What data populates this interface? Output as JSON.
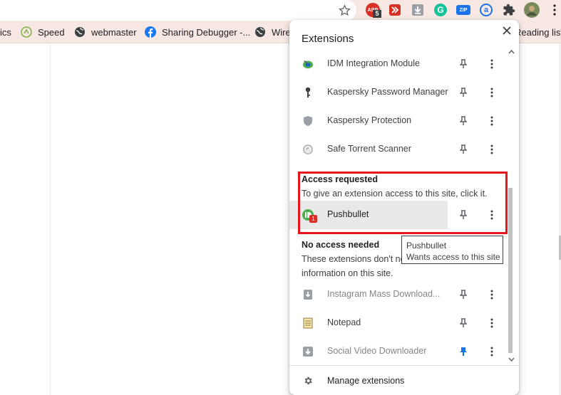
{
  "toolbar": {
    "icons": [
      "star-icon",
      "abp-icon",
      "bookmark-extension-icon",
      "download-icon",
      "grammarly-icon",
      "zip-icon",
      "atavi-icon",
      "extensions-puzzle-icon",
      "profile-avatar",
      "chrome-menu-icon"
    ],
    "abp_label": "ABP",
    "abp_badge": "5",
    "grammarly_label": "G",
    "zip_label": "ZIP",
    "atavi_label": "a"
  },
  "bookmarks": {
    "items": [
      {
        "label": "ics",
        "icon": "none"
      },
      {
        "label": "Speed",
        "icon": "speed-icon"
      },
      {
        "label": "webmaster",
        "icon": "globe-icon"
      },
      {
        "label": "Sharing Debugger -...",
        "icon": "facebook-icon"
      },
      {
        "label": "Wirel",
        "icon": "globe-icon"
      }
    ],
    "reading_list": "Reading list"
  },
  "popup": {
    "title": "Extensions",
    "extensions_top": [
      {
        "name": "IDM Integration Module",
        "icon": "idm-icon"
      },
      {
        "name": "Kaspersky Password Manager",
        "icon": "key-icon"
      },
      {
        "name": "Kaspersky Protection",
        "icon": "shield-icon"
      },
      {
        "name": "Safe Torrent Scanner",
        "icon": "torrent-icon"
      }
    ],
    "access_requested": {
      "title": "Access requested",
      "description": "To give an extension access to this site, click it.",
      "extension": {
        "name": "Pushbullet",
        "badge": "1",
        "icon": "pushbullet-icon"
      }
    },
    "no_access": {
      "title": "No access needed",
      "description_line1": "These extensions don't ne",
      "description_line2": "information on this site.",
      "extensions": [
        {
          "name": "Instagram Mass Download...",
          "icon": "instagram-download-icon",
          "pinned": false
        },
        {
          "name": "Notepad",
          "icon": "notepad-icon",
          "pinned": false
        },
        {
          "name": "Social Video Downloader",
          "icon": "video-download-icon",
          "pinned": true
        }
      ]
    },
    "footer": {
      "label": "Manage extensions"
    }
  },
  "tooltip": {
    "title": "Pushbullet",
    "text": "Wants access to this site"
  },
  "colors": {
    "highlight_border": "#e8141b",
    "pin_active": "#1a73e8",
    "toolbar_bg": "#f8e8e4"
  }
}
